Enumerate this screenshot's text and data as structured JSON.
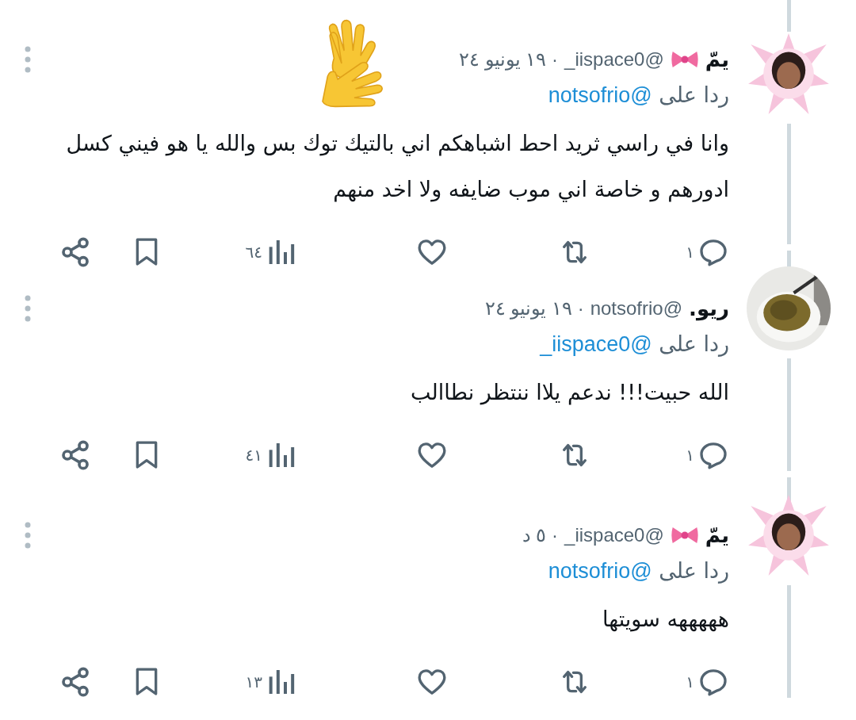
{
  "tweets": [
    {
      "name": "يمّ",
      "badge": {
        "kind": "bow"
      },
      "handle": "@iispace0_",
      "time": "· ١٩ يونيو ٢٤",
      "avatar": {
        "kind": "cartoon"
      },
      "reply_label": "ردا على",
      "reply_to": "@notsofrio",
      "text": "وانا في راسي ثريد احط اشباهكم اني بالتيك توك بس والله يا هو فيني كسل ادورهم و خاصة اني موب ضايفه ولا اخد منهم",
      "sticker": {
        "kind": "waving_hands"
      },
      "replies": "١",
      "views": "٦٤"
    },
    {
      "name": "ريو.",
      "handle": "@notsofrio",
      "time": "· ١٩ يونيو ٢٤",
      "reply_label": "ردا على",
      "reply_to": "@iispace0_",
      "text": "الله حبيت!!! ندعم يلاا ننتظر نطاالب",
      "replies": "١",
      "views": "٤١"
    },
    {
      "name": "يمّ",
      "badge": {
        "kind": "bow"
      },
      "handle": "@iispace0_",
      "time": "· ٥ د",
      "avatar": {
        "kind": "cartoon"
      },
      "reply_label": "ردا على",
      "reply_to": "@notsofrio",
      "text": "هههههه سويتها",
      "replies": "١",
      "views": "١٣"
    }
  ]
}
